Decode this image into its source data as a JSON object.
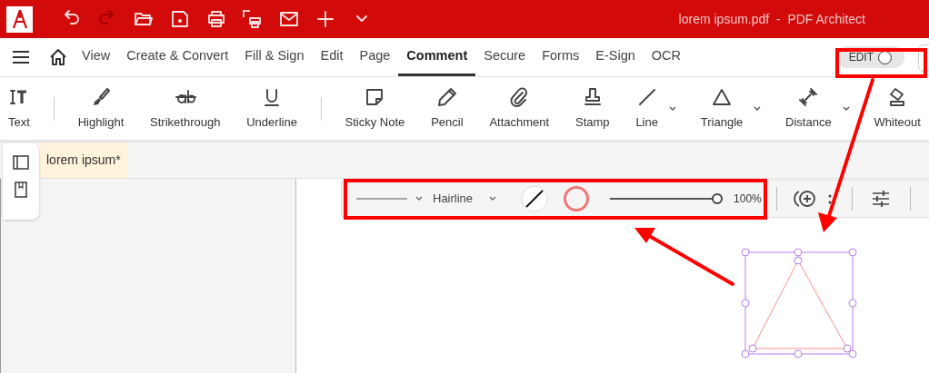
{
  "title_bar": {
    "title": "lorem ipsum.pdf  -  PDF Architect",
    "quick_buttons": [
      {
        "disabled": false
      },
      {
        "disabled": true
      },
      {
        "disabled": false
      },
      {
        "disabled": false
      },
      {
        "disabled": false
      },
      {
        "disabled": false
      },
      {
        "disabled": false
      },
      {
        "disabled": false
      },
      {
        "disabled": false
      }
    ]
  },
  "menu": {
    "tabs": [
      {
        "label": "View",
        "selected": false
      },
      {
        "label": "Create & Convert",
        "selected": false
      },
      {
        "label": "Fill & Sign",
        "selected": false
      },
      {
        "label": "Edit",
        "selected": false
      },
      {
        "label": "Page",
        "selected": false
      },
      {
        "label": "Comment",
        "selected": true
      },
      {
        "label": "Secure",
        "selected": false
      },
      {
        "label": "Forms",
        "selected": false
      },
      {
        "label": "E-Sign",
        "selected": false
      },
      {
        "label": "OCR",
        "selected": false
      }
    ],
    "edit_toggle": {
      "label": "EDIT",
      "on": false
    }
  },
  "tools": [
    {
      "kind": "tool",
      "label": "Text",
      "dropdown": false
    },
    {
      "kind": "separator"
    },
    {
      "kind": "tool",
      "label": "Highlight",
      "dropdown": false
    },
    {
      "kind": "tool",
      "label": "Strikethrough",
      "dropdown": false
    },
    {
      "kind": "tool",
      "label": "Underline",
      "dropdown": false
    },
    {
      "kind": "separator"
    },
    {
      "kind": "tool",
      "label": "Sticky Note",
      "dropdown": false
    },
    {
      "kind": "tool",
      "label": "Pencil",
      "dropdown": false
    },
    {
      "kind": "tool",
      "label": "Attachment",
      "dropdown": false
    },
    {
      "kind": "tool",
      "label": "Stamp",
      "dropdown": false
    },
    {
      "kind": "tool",
      "label": "Line",
      "dropdown": true
    },
    {
      "kind": "tool",
      "label": "Triangle",
      "dropdown": true
    },
    {
      "kind": "tool",
      "label": "Distance",
      "dropdown": true
    },
    {
      "kind": "tool",
      "label": "Whiteout",
      "dropdown": false
    }
  ],
  "document_tabs": [
    {
      "label": "lorem ipsum*",
      "selected": true
    }
  ],
  "annotation_toolbar": {
    "line_width": "Hairline",
    "fill_swatch": {
      "enabled": false
    },
    "stroke_swatch": {
      "color": "#f07878"
    },
    "opacity": {
      "level": 1,
      "reading": "100%"
    }
  }
}
